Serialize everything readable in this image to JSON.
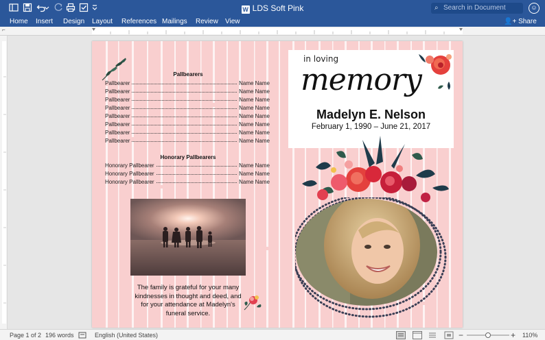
{
  "window": {
    "title": "LDS Soft Pink",
    "app_icon_letter": "W",
    "search_placeholder": "Search in Document"
  },
  "toolbar": {
    "icons": [
      "sidebar-icon",
      "save-icon",
      "undo-icon",
      "undo-dropdown-icon",
      "redo-icon",
      "print-icon",
      "check-icon",
      "customize-icon"
    ]
  },
  "ribbon": {
    "tabs": [
      "Home",
      "Insert",
      "Design",
      "Layout",
      "References",
      "Mailings",
      "Review",
      "View"
    ],
    "share_label": "Share"
  },
  "document": {
    "pallbearers_title": "Pallbearers",
    "pallbearers": [
      {
        "label": "Pallbearer",
        "name": "Name Name"
      },
      {
        "label": "Pallbearer",
        "name": "Name Name"
      },
      {
        "label": "Pallbearer",
        "name": "Name Name"
      },
      {
        "label": "Pallbearer",
        "name": "Name Name"
      },
      {
        "label": "Pallbearer",
        "name": "Name Name"
      },
      {
        "label": "Pallbearer",
        "name": "Name Name"
      },
      {
        "label": "Pallbearer",
        "name": "Name Name"
      },
      {
        "label": "Pallbearer",
        "name": "Name Name"
      }
    ],
    "honorary_title": "Honorary Pallbearers",
    "honorary": [
      {
        "label": "Honorary Pallbearer",
        "name": "Name Name"
      },
      {
        "label": "Honorary Pallbearer",
        "name": "Name Name"
      },
      {
        "label": "Honorary Pallbearer",
        "name": "Name Name"
      }
    ],
    "thanks_text": "The family is grateful for your many kindnesses in thought and deed, and for your attendance at Madelyn's funeral service.",
    "in_loving": "in loving",
    "memory": "memory",
    "deceased_name": "Madelyn E. Nelson",
    "dates": "February 1, 1990 – June 21, 2017"
  },
  "status": {
    "page": "Page 1 of 2",
    "words": "196 words",
    "language": "English (United States)",
    "zoom": "110%"
  },
  "colors": {
    "ribbon_blue": "#2b579a",
    "page_pink": "#f9cfcf",
    "flower_red": "#d8283a",
    "leaf_dark": "#1f3b4a"
  }
}
